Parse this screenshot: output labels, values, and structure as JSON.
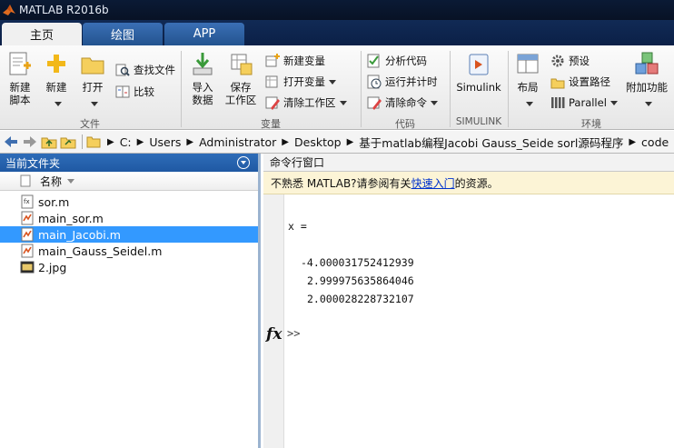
{
  "window": {
    "title": "MATLAB R2016b"
  },
  "tabs": [
    {
      "label": "主页"
    },
    {
      "label": "绘图"
    },
    {
      "label": "APP"
    }
  ],
  "ribbon": {
    "file_group": {
      "new_script": "新建\n脚本",
      "new": "新建",
      "open": "打开",
      "find_files": "查找文件",
      "compare": "比较",
      "label": "文件"
    },
    "variable_group": {
      "import_data": "导入\n数据",
      "save_workspace": "保存\n工作区",
      "new_variable": "新建变量",
      "open_variable": "打开变量",
      "clear_workspace": "清除工作区",
      "label": "变量"
    },
    "code_group": {
      "analyze_code": "分析代码",
      "run_and_time": "运行并计时",
      "clear_commands": "清除命令",
      "label": "代码"
    },
    "simulink_group": {
      "simulink": "Simulink",
      "label": "SIMULINK"
    },
    "environment_group": {
      "layout": "布局",
      "preferences": "预设",
      "set_path": "设置路径",
      "parallel": "Parallel",
      "addons": "附加功能",
      "label": "环境"
    }
  },
  "address": {
    "crumbs": [
      "C:",
      "Users",
      "Administrator",
      "Desktop",
      "基于matlab编程Jacobi Gauss_Seide sorl源码程序",
      "code"
    ]
  },
  "file_browser": {
    "title": "当前文件夹",
    "column_name": "名称",
    "files": [
      {
        "name": "sor.m",
        "type": "script-m"
      },
      {
        "name": "main_sor.m",
        "type": "function-m"
      },
      {
        "name": "main_Jacobi.m",
        "type": "function-m",
        "selected": true
      },
      {
        "name": "main_Gauss_Seidel.m",
        "type": "function-m"
      },
      {
        "name": "2.jpg",
        "type": "image-jpg"
      }
    ]
  },
  "command_window": {
    "title": "命令行窗口",
    "tip_prefix": "不熟悉 MATLAB?请参阅有关",
    "tip_link": "快速入门",
    "tip_suffix": "的资源。",
    "output_var": "x =",
    "values": [
      "-4.000031752412939",
      "2.999975635864046",
      "2.000028228732107"
    ],
    "fx_label": "fx",
    "prompt": ">>"
  }
}
